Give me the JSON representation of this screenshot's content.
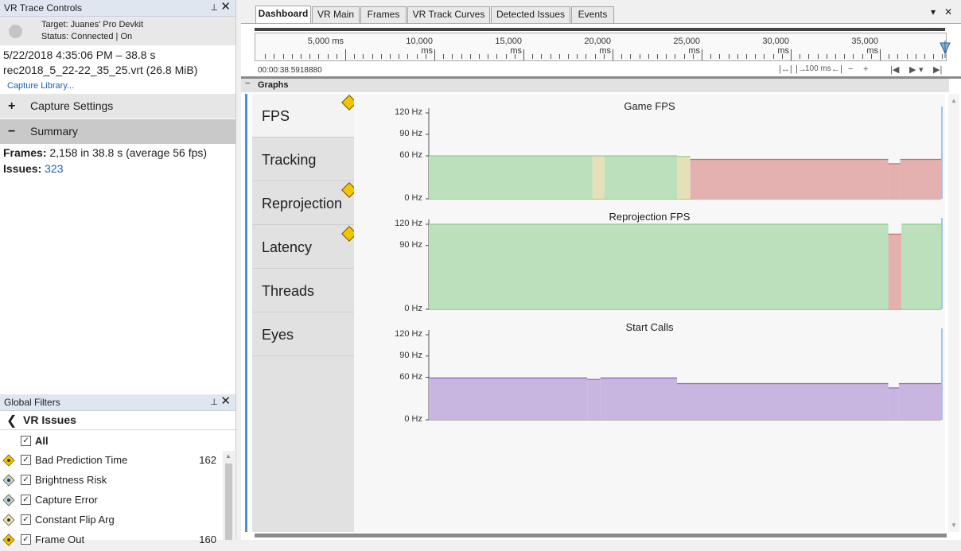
{
  "trace_controls": {
    "title": "VR Trace Controls",
    "pin_icon": "⊥",
    "close_icon": "✕",
    "target": "Target: Juanes' Pro Devkit",
    "status": "Status: Connected | On",
    "capture_time": "5/22/2018 4:35:06 PM – 38.8 s",
    "capture_file": "rec2018_5_22-22_35_25.vrt (26.8 MiB)",
    "capture_library": "Capture Library...",
    "capture_settings": {
      "symbol": "+",
      "label": "Capture Settings"
    },
    "summary": {
      "symbol": "−",
      "label": "Summary"
    },
    "frames_label": "Frames:",
    "frames_value": "2,158 in 38.8 s (average 56 fps)",
    "issues_label": "Issues:",
    "issues_value": "323"
  },
  "global_filters": {
    "title": "Global Filters",
    "back_icon": "❮",
    "heading": "VR Issues",
    "all_label": "All",
    "check": "✓",
    "items": [
      {
        "label": "Bad Prediction Time",
        "count": "162",
        "icon": "warning-eye-icon",
        "color": "#f5c400"
      },
      {
        "label": "Brightness Risk",
        "count": "",
        "icon": "brightness-eye-icon",
        "color": "#b9d3df"
      },
      {
        "label": "Capture Error",
        "count": "",
        "icon": "capture-eye-icon",
        "color": "#b9d3df"
      },
      {
        "label": "Constant Flip Arg",
        "count": "",
        "icon": "flip-eye-icon",
        "color": "#efe3c0"
      },
      {
        "label": "Frame Out",
        "count": "160",
        "icon": "warning-eye-icon",
        "color": "#f5c400"
      }
    ]
  },
  "tabs": [
    {
      "label": "Dashboard",
      "active": true
    },
    {
      "label": "VR Main",
      "active": false
    },
    {
      "label": "Frames",
      "active": false
    },
    {
      "label": "VR Track Curves",
      "active": false
    },
    {
      "label": "Detected Issues",
      "active": false
    },
    {
      "label": "Events",
      "active": false
    }
  ],
  "tab_controls": {
    "dropdown": "▾",
    "close": "✕"
  },
  "timeline": {
    "ticks": [
      "5,000 ms",
      "10,000 ms",
      "15,000 ms",
      "20,000 ms",
      "25,000 ms",
      "30,000 ms",
      "35,000 ms"
    ],
    "timecode": "00:00:38.5918880",
    "zoom_label": "100 ms",
    "tools": [
      "|↔|",
      "|→",
      "←|",
      "−",
      "+",
      "|◀",
      "▶",
      "▾",
      "▶|"
    ]
  },
  "graphs": {
    "title": "Graphs",
    "collapse_symbol": "−",
    "nav": [
      {
        "label": "FPS",
        "warning": true,
        "selected": true
      },
      {
        "label": "Tracking",
        "warning": false,
        "selected": false
      },
      {
        "label": "Reprojection",
        "warning": true,
        "selected": false
      },
      {
        "label": "Latency",
        "warning": true,
        "selected": false
      },
      {
        "label": "Threads",
        "warning": false,
        "selected": false
      },
      {
        "label": "Eyes",
        "warning": false,
        "selected": false
      }
    ]
  },
  "colors": {
    "good": "#bcdfbc",
    "good_line": "#8fcf8f",
    "bad": "#e5b0b0",
    "bad_line": "#d26a6a",
    "warn": "#e6e0b8",
    "purple": "#c9b6e0",
    "purple_line": "#8a62c0",
    "accent": "#4a90e2"
  },
  "chart_data": [
    {
      "type": "area",
      "title": "Game FPS",
      "ytick_labels": [
        "120 Hz",
        "90 Hz",
        "60 Hz",
        "0 Hz"
      ],
      "ytick_values": [
        120,
        90,
        60,
        0
      ],
      "ylim": [
        0,
        120
      ],
      "xlim": [
        0,
        38.8
      ],
      "segments": [
        {
          "x0": 0,
          "x1": 12.4,
          "y": 60,
          "color": "good"
        },
        {
          "x0": 12.4,
          "x1": 13.3,
          "y": 60,
          "color": "warn"
        },
        {
          "x0": 13.3,
          "x1": 18.8,
          "y": 60,
          "color": "good"
        },
        {
          "x0": 18.8,
          "x1": 19.8,
          "y": 59,
          "color": "warn"
        },
        {
          "x0": 19.8,
          "x1": 34.8,
          "y": 55,
          "color": "bad"
        },
        {
          "x0": 34.8,
          "x1": 35.7,
          "y": 49,
          "color": "bad"
        },
        {
          "x0": 35.7,
          "x1": 38.8,
          "y": 55,
          "color": "bad"
        }
      ]
    },
    {
      "type": "area",
      "title": "Reprojection FPS",
      "ytick_labels": [
        "120 Hz",
        "90 Hz",
        "0 Hz"
      ],
      "ytick_values": [
        120,
        90,
        0
      ],
      "ylim": [
        0,
        120
      ],
      "xlim": [
        0,
        38.8
      ],
      "segments": [
        {
          "x0": 0,
          "x1": 34.8,
          "y": 120,
          "color": "good"
        },
        {
          "x0": 34.8,
          "x1": 35.8,
          "y": 106,
          "color": "bad"
        },
        {
          "x0": 35.8,
          "x1": 38.8,
          "y": 120,
          "color": "good"
        }
      ]
    },
    {
      "type": "area",
      "title": "Start Calls",
      "ytick_labels": [
        "120 Hz",
        "90 Hz",
        "60 Hz",
        "0 Hz"
      ],
      "ytick_values": [
        120,
        90,
        60,
        0
      ],
      "ylim": [
        0,
        120
      ],
      "xlim": [
        0,
        38.8
      ],
      "segments": [
        {
          "x0": 0,
          "x1": 12.0,
          "y": 59,
          "color": "purple"
        },
        {
          "x0": 12.0,
          "x1": 13.0,
          "y": 57,
          "color": "purple"
        },
        {
          "x0": 13.0,
          "x1": 18.8,
          "y": 59,
          "color": "purple"
        },
        {
          "x0": 18.8,
          "x1": 34.8,
          "y": 51,
          "color": "purple"
        },
        {
          "x0": 34.8,
          "x1": 35.6,
          "y": 45,
          "color": "purple"
        },
        {
          "x0": 35.6,
          "x1": 38.8,
          "y": 51,
          "color": "purple"
        }
      ]
    }
  ]
}
